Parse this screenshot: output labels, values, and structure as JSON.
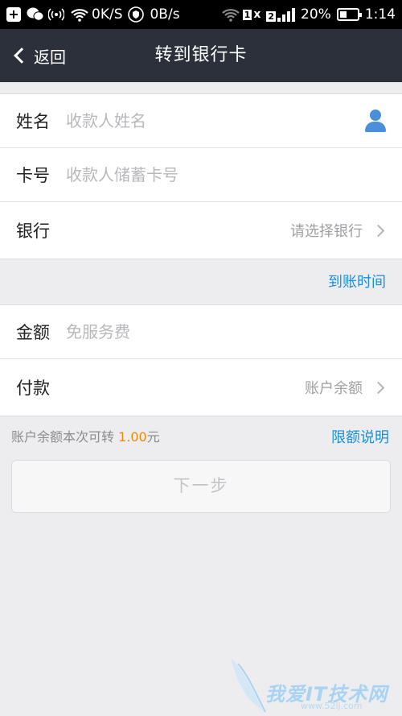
{
  "status_bar": {
    "speed_1": "0K/S",
    "speed_2": "0B/s",
    "sim_1": "1",
    "sim_2": "2",
    "battery": "20%",
    "time": "1:14"
  },
  "nav": {
    "back_label": "返回",
    "title": "转到银行卡"
  },
  "form": {
    "name": {
      "label": "姓名",
      "placeholder": "收款人姓名"
    },
    "card": {
      "label": "卡号",
      "placeholder": "收款人储蓄卡号"
    },
    "bank": {
      "label": "银行",
      "value": "请选择银行"
    }
  },
  "arrival_time_link": "到账时间",
  "payment": {
    "amount": {
      "label": "金额",
      "placeholder": "免服务费"
    },
    "method": {
      "label": "付款",
      "value": "账户余额"
    }
  },
  "limit_note": {
    "prefix": "账户余额本次可转",
    "amount": "1.00",
    "suffix": "元"
  },
  "limit_link": "限额说明",
  "next_button": "下一步",
  "watermark": {
    "text": "我爱IT技术网",
    "url": "www.52ij.com"
  },
  "colors": {
    "nav_bg": "#2b303b",
    "link": "#1a8fe0",
    "amount": "#f08a00",
    "contact_icon": "#4a8fd9"
  }
}
